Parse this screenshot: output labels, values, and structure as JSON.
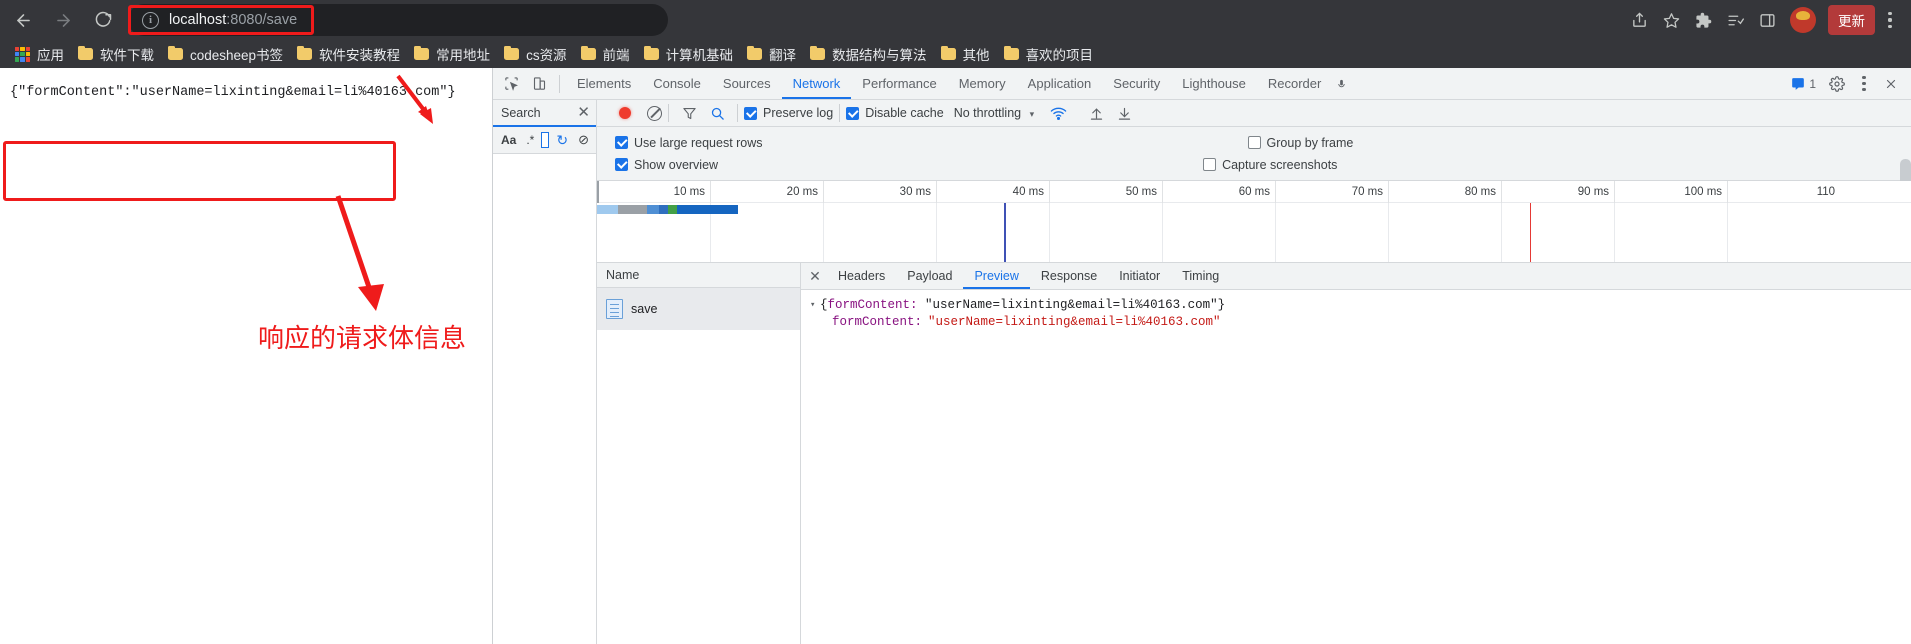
{
  "browser": {
    "nav": {
      "back_icon": "arrow-left-icon",
      "forward_icon": "arrow-right-icon",
      "reload_icon": "reload-icon"
    },
    "omnibox": {
      "info_icon": "page-info-icon",
      "info_glyph": "i",
      "url_host": "localhost",
      "url_rest": ":8080/save",
      "full_url": "localhost:8080/save"
    },
    "right_actions": [
      {
        "name": "share-icon",
        "label": "Share"
      },
      {
        "name": "bookmark-star-icon",
        "label": "Bookmark this tab"
      },
      {
        "name": "extensions-puzzle-icon",
        "label": "Extensions"
      },
      {
        "name": "reading-list-icon",
        "label": "Reading list"
      },
      {
        "name": "side-panel-icon",
        "label": "Side panel"
      }
    ],
    "profile": {
      "name": "profile-avatar",
      "label": "Profile"
    },
    "update_button": "更新",
    "menu_icon": "three-dot-menu-icon"
  },
  "bookmarks": [
    {
      "icon": "apps-grid-icon",
      "label": "应用"
    },
    {
      "icon": "folder-icon",
      "label": "软件下载"
    },
    {
      "icon": "folder-icon",
      "label": "codesheep书签"
    },
    {
      "icon": "folder-icon",
      "label": "软件安装教程"
    },
    {
      "icon": "folder-icon",
      "label": "常用地址"
    },
    {
      "icon": "folder-icon",
      "label": "cs资源"
    },
    {
      "icon": "folder-icon",
      "label": "前端"
    },
    {
      "icon": "folder-icon",
      "label": "计算机基础"
    },
    {
      "icon": "folder-icon",
      "label": "翻译"
    },
    {
      "icon": "folder-icon",
      "label": "数据结构与算法"
    },
    {
      "icon": "folder-icon",
      "label": "其他"
    },
    {
      "icon": "folder-icon",
      "label": "喜欢的项目"
    }
  ],
  "page": {
    "response_body": "{\"formContent\":\"userName=lixinting&email=li%40163.com\"}"
  },
  "annotations": {
    "caption": "响应的请求体信息",
    "color": "#ef1b1b"
  },
  "devtools": {
    "panel_tools": [
      {
        "name": "inspect-element-icon",
        "label": "Inspect element"
      },
      {
        "name": "device-toolbar-icon",
        "label": "Toggle device toolbar"
      }
    ],
    "tabs": [
      {
        "label": "Elements",
        "active": false
      },
      {
        "label": "Console",
        "active": false
      },
      {
        "label": "Sources",
        "active": false
      },
      {
        "label": "Network",
        "active": true
      },
      {
        "label": "Performance",
        "active": false
      },
      {
        "label": "Memory",
        "active": false
      },
      {
        "label": "Application",
        "active": false
      },
      {
        "label": "Security",
        "active": false
      },
      {
        "label": "Lighthouse",
        "active": false
      },
      {
        "label": "Recorder",
        "active": false
      }
    ],
    "message_badge_count": "1",
    "right_icons": [
      {
        "name": "devtools-messages-icon",
        "label": "Messages"
      },
      {
        "name": "settings-gear-icon",
        "label": "Settings"
      },
      {
        "name": "devtools-more-icon",
        "label": "More options"
      },
      {
        "name": "devtools-close-icon",
        "label": "Close DevTools"
      }
    ],
    "search_pane": {
      "title": "Search",
      "close_icon": "close-icon",
      "tools": [
        {
          "name": "match-case-icon",
          "label": "Aa"
        },
        {
          "name": "regex-icon",
          "label": ".*"
        },
        {
          "name": "refresh-icon",
          "label": "↻"
        },
        {
          "name": "clear-icon",
          "label": "⊘"
        }
      ]
    },
    "network_toolbar": {
      "record_button": {
        "name": "record-button",
        "state": "recording"
      },
      "clear_button": {
        "name": "clear-network-log-button"
      },
      "filter_icon": "filter-icon",
      "search_icon": "search-icon",
      "preserve_log": {
        "label": "Preserve log",
        "checked": true
      },
      "disable_cache": {
        "label": "Disable cache",
        "checked": true
      },
      "throttling": {
        "label": "No throttling",
        "caret": "▾"
      },
      "wifi_icon": "network-conditions-icon",
      "import_icon": "import-har-icon",
      "export_icon": "export-har-icon"
    },
    "network_options": {
      "use_large_request_rows": {
        "label": "Use large request rows",
        "checked": true
      },
      "group_by_frame": {
        "label": "Group by frame",
        "checked": false
      },
      "show_overview": {
        "label": "Show overview",
        "checked": true
      },
      "capture_screenshots": {
        "label": "Capture screenshots",
        "checked": false
      }
    },
    "overview": {
      "ticks": [
        "10 ms",
        "20 ms",
        "30 ms",
        "40 ms",
        "50 ms",
        "60 ms",
        "70 ms",
        "80 ms",
        "90 ms",
        "100 ms",
        "110"
      ],
      "bar_segments": [
        {
          "color": "#8bc0ea",
          "width_pct": 2
        },
        {
          "color": "#9aa0a6",
          "width_pct": 3
        },
        {
          "color": "#2196f3",
          "width_pct": 5
        },
        {
          "color": "#1565c0",
          "width_pct": 1
        },
        {
          "color": "#43a047",
          "width_pct": 1
        },
        {
          "color": "#1565c0",
          "width_pct": 8
        }
      ],
      "red_marker_ms": 80,
      "blue_marker_ms": 38
    },
    "request_list": {
      "column_header": "Name",
      "rows": [
        {
          "icon": "document-icon",
          "name": "save",
          "selected": true
        }
      ]
    },
    "detail": {
      "close_icon": "close-icon",
      "tabs": [
        {
          "label": "Headers",
          "active": false
        },
        {
          "label": "Payload",
          "active": false
        },
        {
          "label": "Preview",
          "active": true
        },
        {
          "label": "Response",
          "active": false
        },
        {
          "label": "Initiator",
          "active": false
        },
        {
          "label": "Timing",
          "active": false
        }
      ],
      "preview": {
        "root_arrow": "▾",
        "root_open": "{",
        "root_key": "formContent:",
        "root_value": " \"userName=lixinting&email=li%40163.com\"",
        "root_close": "}",
        "child_key": "formContent:",
        "child_value": "\"userName=lixinting&email=li%40163.com\""
      }
    }
  }
}
